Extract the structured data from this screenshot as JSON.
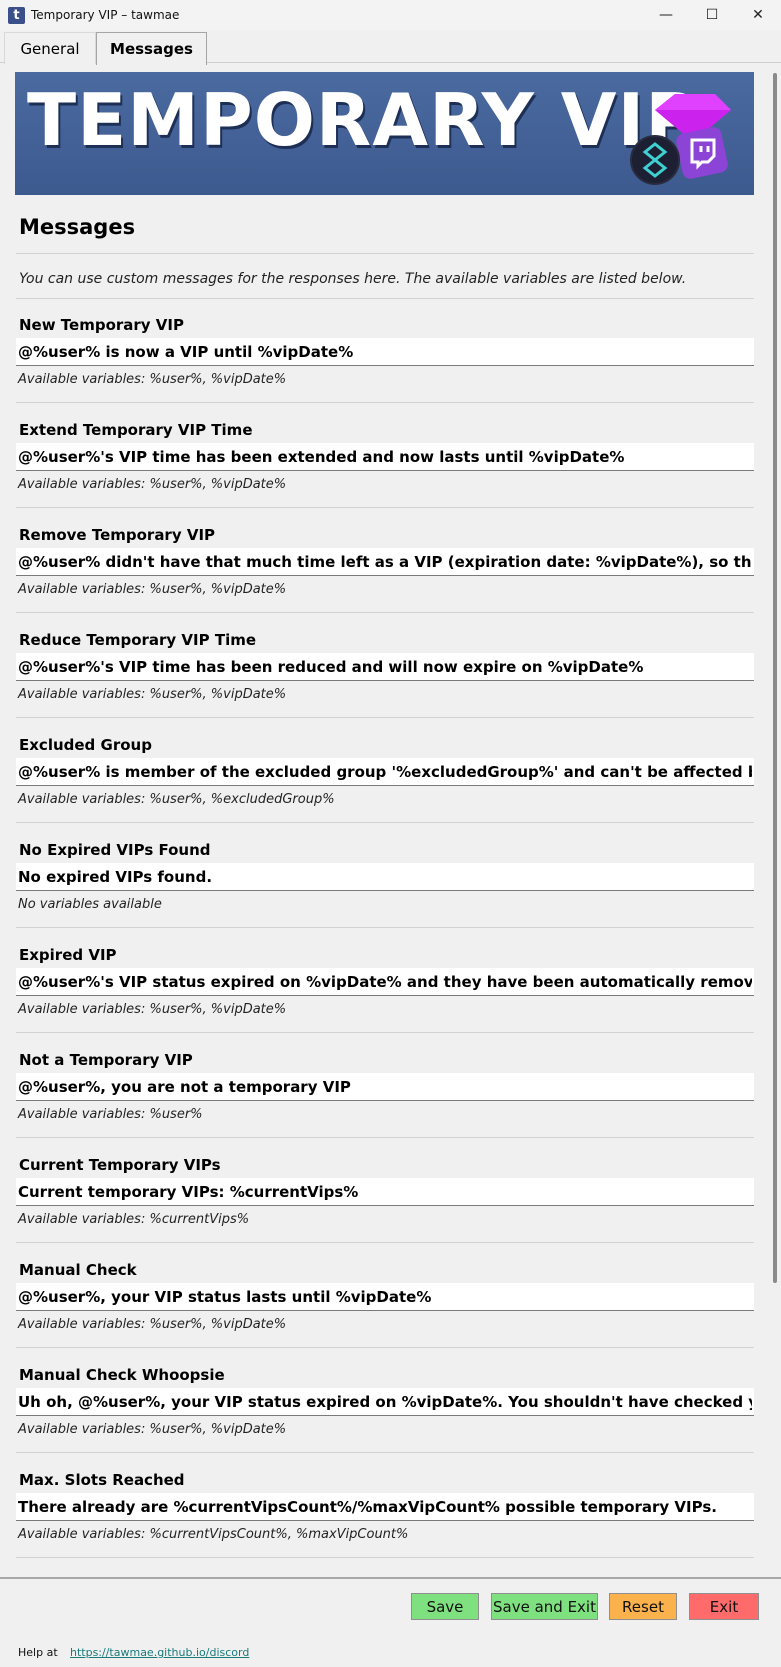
{
  "window": {
    "title": "Temporary VIP – tawmae",
    "app_icon_letter": "t",
    "minimize": "—",
    "maximize": "☐",
    "close": "✕"
  },
  "tabs": [
    {
      "label": "General",
      "active": false
    },
    {
      "label": "Messages",
      "active": true
    }
  ],
  "banner": {
    "title": "TEMPORARY VIP"
  },
  "page": {
    "heading": "Messages",
    "intro": "You can use custom messages for the responses here. The available variables are listed below."
  },
  "sections": [
    {
      "label": "New Temporary VIP",
      "value": "@%user% is now a VIP until %vipDate%",
      "vars": "Available variables: %user%, %vipDate%"
    },
    {
      "label": "Extend Temporary VIP Time",
      "value": "@%user%'s VIP time has been extended and now lasts until %vipDate%",
      "vars": "Available variables: %user%, %vipDate%"
    },
    {
      "label": "Remove Temporary VIP",
      "value": "@%user% didn't have that much time left as a VIP (expiration date: %vipDate%), so they have nc",
      "vars": "Available variables: %user%, %vipDate%"
    },
    {
      "label": "Reduce Temporary VIP Time",
      "value": "@%user%'s VIP time has been reduced and will now expire on %vipDate%",
      "vars": "Available variables: %user%, %vipDate%"
    },
    {
      "label": "Excluded Group",
      "value": "@%user% is member of the excluded group '%excludedGroup%' and can't be affected by Tempo",
      "vars": "Available variables: %user%, %excludedGroup%"
    },
    {
      "label": "No Expired VIPs Found",
      "value": "No expired VIPs found.",
      "vars": "No variables available"
    },
    {
      "label": "Expired VIP",
      "value": "@%user%'s VIP status expired on %vipDate% and they have been automatically removed as a VI",
      "vars": "Available variables: %user%, %vipDate%"
    },
    {
      "label": "Not a Temporary VIP",
      "value": "@%user%, you are not a temporary VIP",
      "vars": "Available variables: %user%"
    },
    {
      "label": "Current Temporary VIPs",
      "value": "Current temporary VIPs: %currentVips%",
      "vars": "Available variables: %currentVips%"
    },
    {
      "label": "Manual Check",
      "value": "@%user%, your VIP status lasts until %vipDate%",
      "vars": "Available variables: %user%, %vipDate%"
    },
    {
      "label": "Manual Check Whoopsie",
      "value": "Uh oh, @%user%, your VIP status expired on %vipDate%. You shouldn't have checked your status",
      "vars": "Available variables: %user%, %vipDate%"
    },
    {
      "label": "Max. Slots Reached",
      "value": "There already are %currentVipsCount%/%maxVipCount% possible temporary VIPs.",
      "vars": "Available variables: %currentVipsCount%, %maxVipCount%"
    }
  ],
  "footer": {
    "save": "Save",
    "save_exit": "Save and Exit",
    "reset": "Reset",
    "exit": "Exit",
    "help_label": "Help at",
    "help_link": "https://tawmae.github.io/discord"
  },
  "colors": {
    "save": "#7fe07f",
    "reset": "#fbb14c",
    "exit": "#ff6b6b",
    "banner": "#3d5a8f"
  }
}
